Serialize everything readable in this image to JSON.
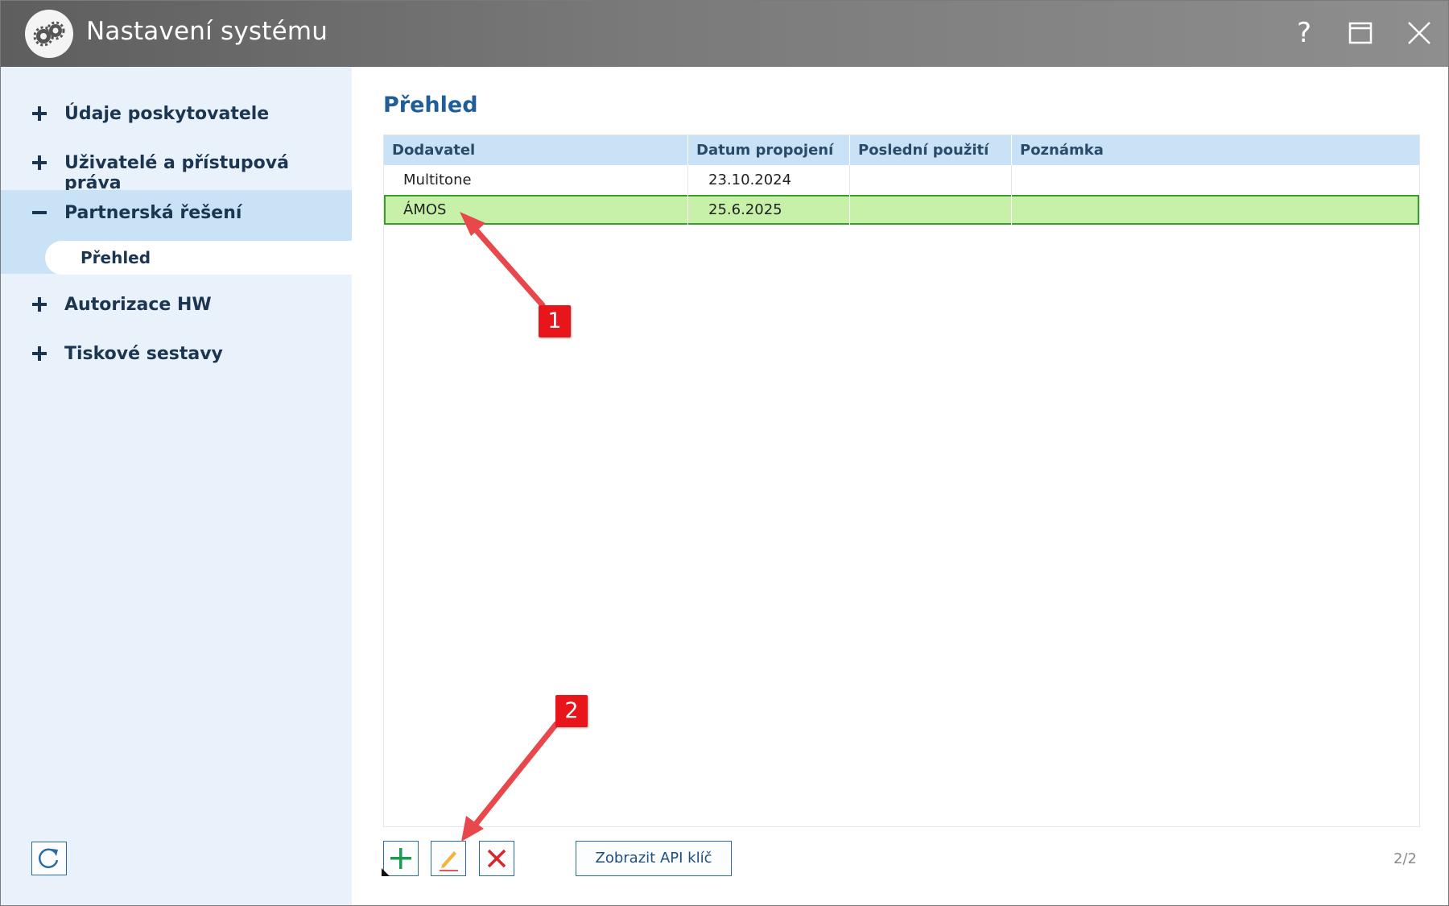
{
  "window": {
    "title": "Nastavení systému",
    "help_label": "?"
  },
  "sidebar": {
    "items": [
      {
        "label": "Údaje poskytovatele",
        "expanded": false
      },
      {
        "label": "Uživatelé a přístupová práva",
        "expanded": false
      },
      {
        "label": "Partnerská řešení",
        "expanded": true
      },
      {
        "label": "Autorizace HW",
        "expanded": false
      },
      {
        "label": "Tiskové sestavy",
        "expanded": false
      }
    ],
    "subitem": {
      "label": "Přehled",
      "selected": true
    }
  },
  "main": {
    "title": "Přehled",
    "table": {
      "columns": [
        "Dodavatel",
        "Datum propojení",
        "Poslední použití",
        "Poznámka"
      ],
      "rows": [
        {
          "dodavatel": "Multitone",
          "datum": "23.10.2024",
          "posledni": "",
          "poznamka": "",
          "selected": false
        },
        {
          "dodavatel": "ÁMOS",
          "datum": "25.6.2025",
          "posledni": "",
          "poznamka": "",
          "selected": true
        }
      ]
    },
    "actions": {
      "api_key_label": "Zobrazit API klíč",
      "pager": "2/2"
    }
  },
  "annotations": {
    "badge_1": "1",
    "badge_2": "2"
  },
  "colors": {
    "titlebar": "#6f6f6f",
    "sidebar_bg": "#e9f2fa",
    "sidebar_active": "#c9e2f5",
    "header_bg": "#c9e2f5",
    "selected_row": "#c7f1a8",
    "selected_border": "#3a9a2c",
    "heading": "#1f5e96",
    "annotation": "#e8151b"
  },
  "icons": {
    "app": "gears-icon",
    "maximize": "maximize-icon",
    "close": "close-icon",
    "expand": "plus-icon",
    "collapse": "minus-icon",
    "refresh": "refresh-icon",
    "add": "plus-icon",
    "edit": "pencil-icon",
    "delete": "delete-x-icon"
  }
}
